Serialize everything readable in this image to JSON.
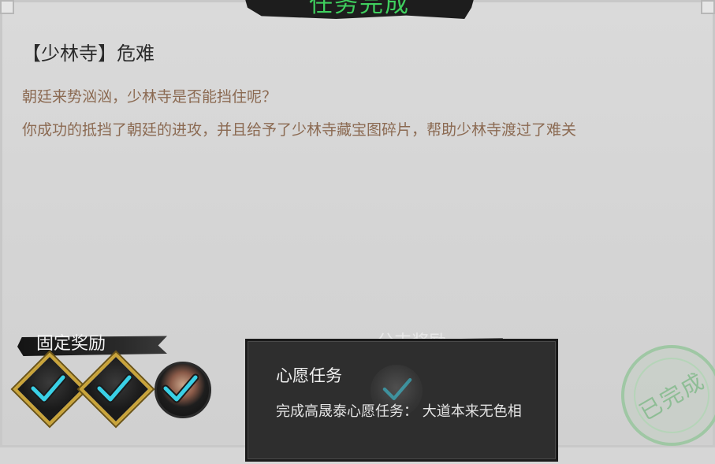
{
  "header": {
    "title": "任务完成"
  },
  "quest": {
    "title": "【少林寺】危难",
    "description_lines": [
      "朝廷来势汹汹，少林寺是否能挡住呢？",
      "你成功的抵挡了朝廷的进攻，并且给予了少林寺藏宝图碎片，帮助少林寺渡过了难关"
    ]
  },
  "rewards": {
    "fixed_label": "固定奖励",
    "branch_label": "分支奖励",
    "items": [
      {
        "icon": "scroll-book-icon",
        "claimed": true
      },
      {
        "icon": "scroll-book-icon",
        "claimed": true
      },
      {
        "icon": "hero-portrait-icon",
        "claimed": true
      }
    ]
  },
  "tooltip": {
    "title": "心愿任务",
    "description": "完成高晟泰心愿任务：  大道本来无色相"
  },
  "stamp": {
    "text": "已完成"
  },
  "colors": {
    "title_green": "#3fcf5e",
    "desc_brown": "#8b6a52",
    "check_cyan": "#3ad0e6"
  }
}
